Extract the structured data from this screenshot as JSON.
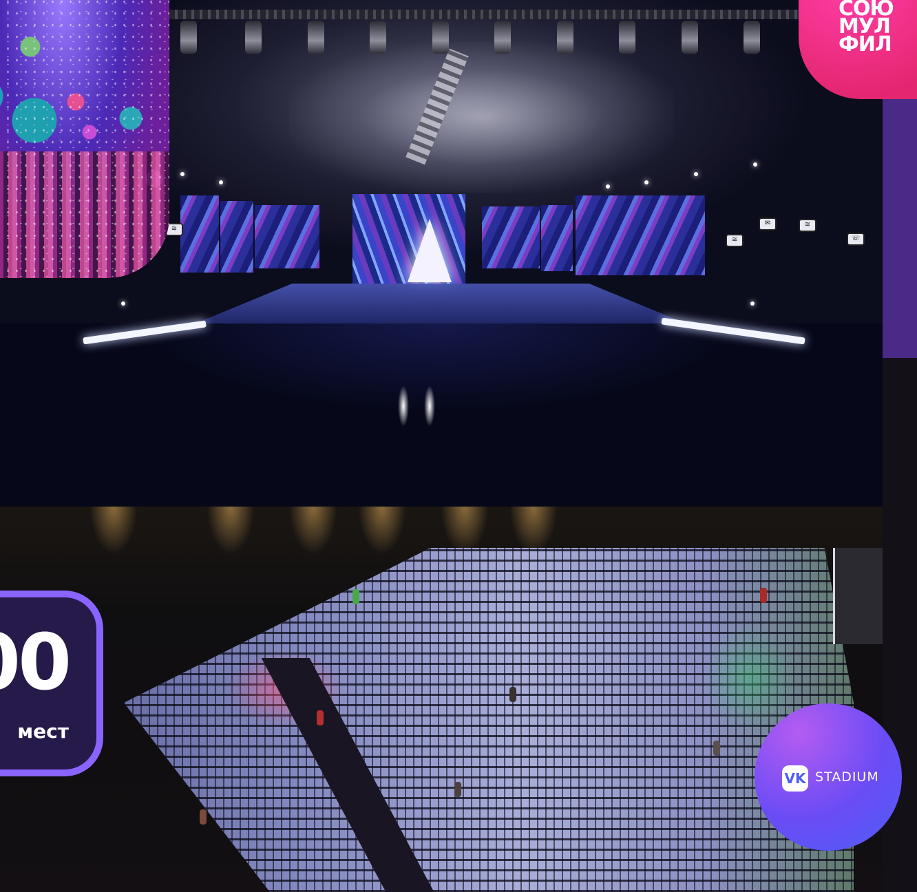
{
  "brand": {
    "lines": [
      "СОЮ",
      "МУЛ",
      "ФИЛ"
    ],
    "color": "#e3266f"
  },
  "seats_badge": {
    "number": "00",
    "label": "мест",
    "border_color": "#8a64ff",
    "fill_color": "#251a4a"
  },
  "venue_badge": {
    "logo": "VK",
    "text": "STADIUM",
    "gradient": [
      "#b45cf2",
      "#4e5ef7"
    ]
  },
  "images": {
    "party_photo": "crowd-with-balloons-confetti",
    "stage_render": "concert-stage-with-led-screens-and-tree",
    "hall_render": "arena-seating-hall"
  }
}
